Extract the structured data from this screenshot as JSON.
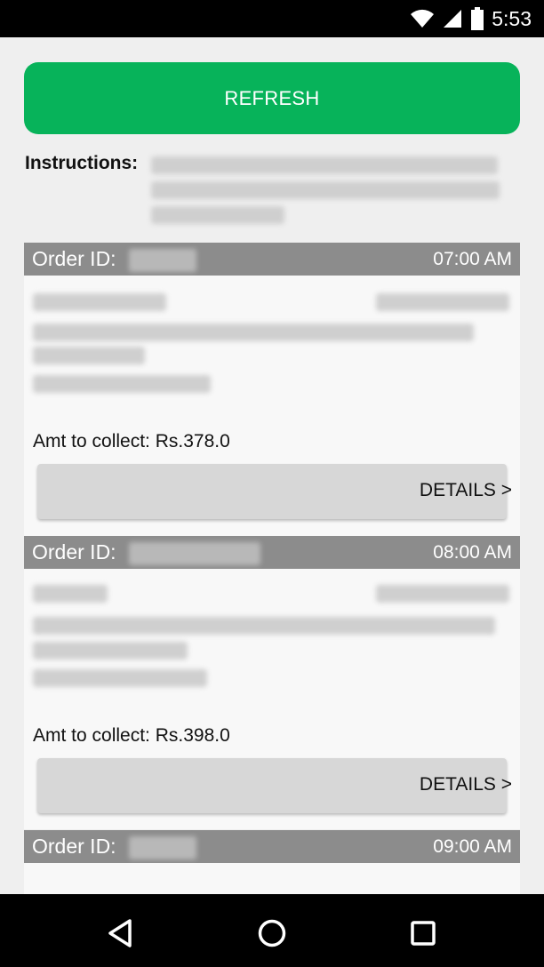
{
  "status_bar": {
    "time": "5:53",
    "icons": [
      "wifi-icon",
      "signal-icon",
      "battery-icon"
    ]
  },
  "refresh_label": "REFRESH",
  "instructions": {
    "label": "Instructions:"
  },
  "orders": [
    {
      "id_label": "Order ID:",
      "time": "07:00 AM",
      "amount": "Amt to collect: Rs.378.0",
      "details_label": "DETAILS >"
    },
    {
      "id_label": "Order ID:",
      "time": "08:00 AM",
      "amount": "Amt to collect: Rs.398.0",
      "details_label": "DETAILS >"
    },
    {
      "id_label": "Order ID:",
      "time": "09:00 AM"
    }
  ],
  "colors": {
    "accent": "#07b35a",
    "order_header": "#8c8c8c",
    "background": "#efefef"
  },
  "nav": [
    "back-icon",
    "home-icon",
    "recents-icon"
  ]
}
